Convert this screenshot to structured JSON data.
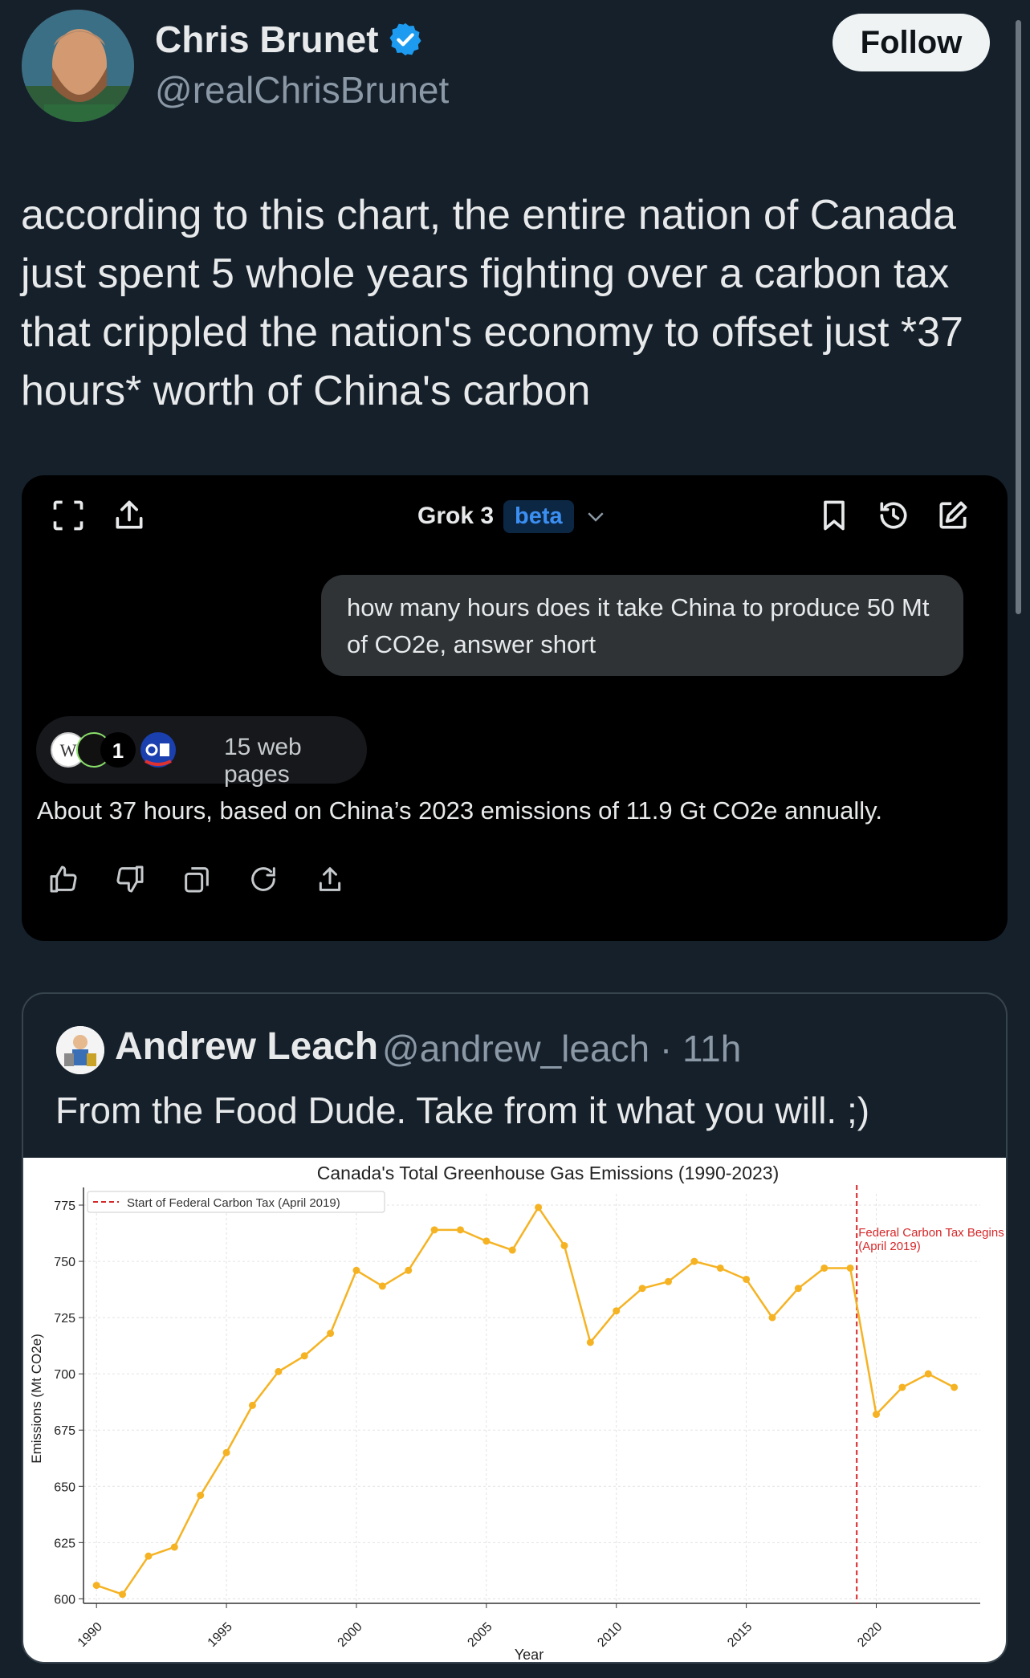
{
  "tweet": {
    "display_name": "Chris Brunet",
    "handle": "@realChrisBrunet",
    "follow_label": "Follow",
    "text": "according to this chart, the entire nation of Canada just spent 5 whole years fighting over a carbon tax that crippled the nation's economy to offset just *37 hours* worth of China's carbon"
  },
  "grok": {
    "title": "Grok 3",
    "badge": "beta",
    "user_message": "how many hours does it take China to produce 50 Mt of CO2e, answer short",
    "sources_label": "15 web pages",
    "answer": "About 37 hours, based on China’s 2023 emissions of 11.9 Gt CO2e annually.",
    "top_icons": [
      "expand-icon",
      "share-icon",
      "bookmark-icon",
      "history-icon",
      "edit-icon"
    ],
    "action_icons": [
      "thumbs-up-icon",
      "thumbs-down-icon",
      "copy-icon",
      "regenerate-icon",
      "share-icon"
    ]
  },
  "quote": {
    "display_name": "Andrew Leach",
    "handle_time": "@andrew_leach · 11h",
    "text": "From the Food Dude. Take from it what you will. ;)"
  },
  "colors": {
    "background": "#15202b",
    "verified": "#1d9bf0",
    "line": "#f5b324",
    "tax_line": "#d62728"
  },
  "chart_data": {
    "type": "line",
    "title": "Canada's Total Greenhouse Gas Emissions (1990-2023)",
    "xlabel": "Year",
    "ylabel": "Emissions (Mt CO2e)",
    "xlim": [
      1989.5,
      2024
    ],
    "ylim": [
      598,
      780
    ],
    "xticks": [
      1990,
      1995,
      2000,
      2005,
      2010,
      2015,
      2020
    ],
    "yticks": [
      600,
      625,
      650,
      675,
      700,
      725,
      750,
      775
    ],
    "grid": true,
    "legend": {
      "position": "top-left",
      "label": "Start of Federal Carbon Tax (April 2019)"
    },
    "annotation": {
      "x": 2019.25,
      "line1": "Federal Carbon Tax Begins",
      "line2": "(April 2019)"
    },
    "x": [
      1990,
      1991,
      1992,
      1993,
      1994,
      1995,
      1996,
      1997,
      1998,
      1999,
      2000,
      2001,
      2002,
      2003,
      2004,
      2005,
      2006,
      2007,
      2008,
      2009,
      2010,
      2011,
      2012,
      2013,
      2014,
      2015,
      2016,
      2017,
      2018,
      2019,
      2020,
      2021,
      2022,
      2023
    ],
    "values": [
      606,
      602,
      619,
      623,
      646,
      665,
      686,
      701,
      708,
      718,
      746,
      739,
      746,
      764,
      764,
      759,
      755,
      774,
      757,
      714,
      728,
      738,
      741,
      750,
      747,
      742,
      725,
      738,
      747,
      747,
      682,
      694,
      700,
      694
    ]
  }
}
